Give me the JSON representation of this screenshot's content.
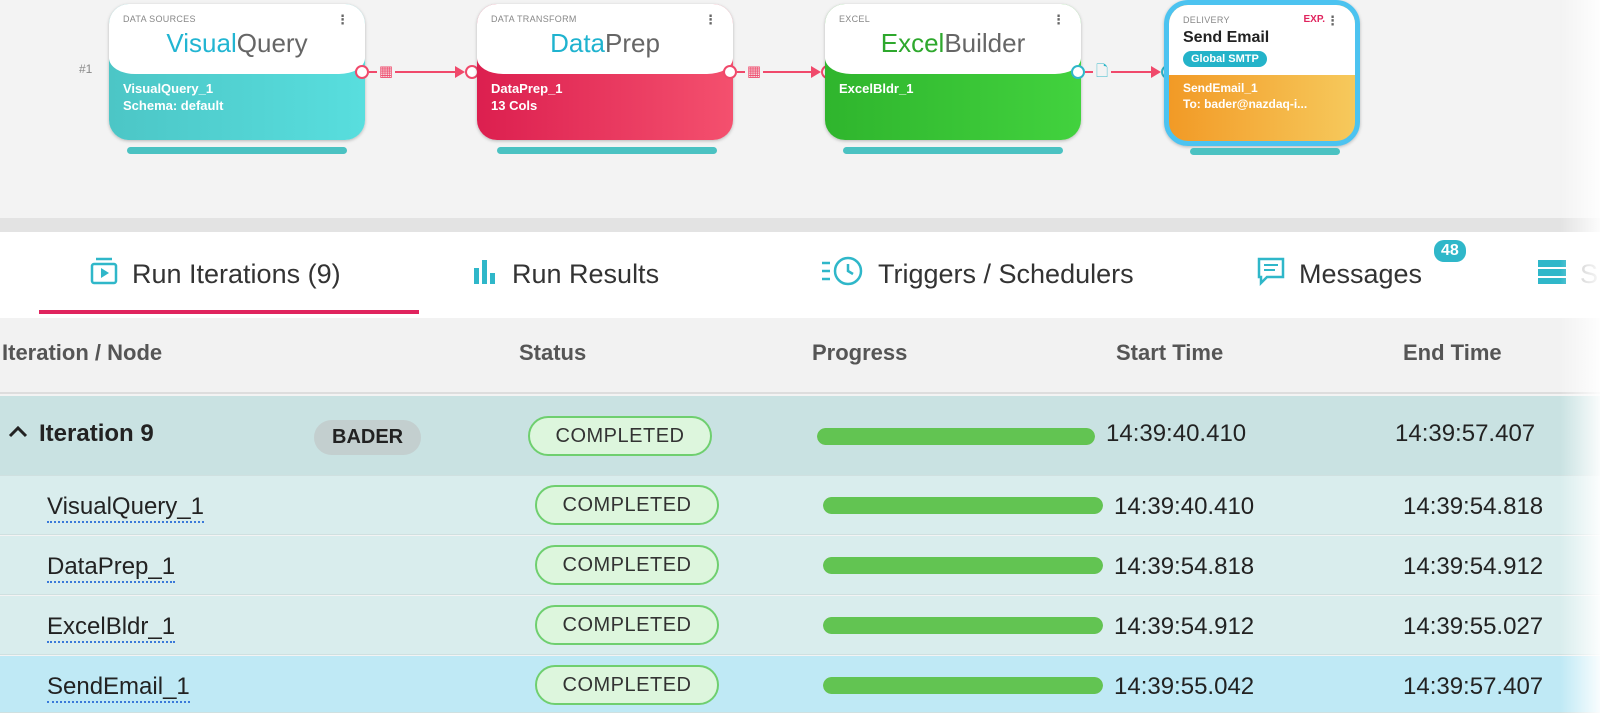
{
  "pipeline": {
    "row_label": "#1",
    "nodes": [
      {
        "category": "DATA SOURCES",
        "logo_a": "Visual",
        "logo_b": "Query",
        "line1": "VisualQuery_1",
        "line2": "Schema: default"
      },
      {
        "category": "DATA TRANSFORM",
        "logo_a": "Data",
        "logo_b": "Prep",
        "line1": "DataPrep_1",
        "line2": "13 Cols"
      },
      {
        "category": "EXCEL",
        "logo_a": "Excel",
        "logo_b": "Builder",
        "line1": "ExcelBldr_1",
        "line2": ""
      },
      {
        "category": "DELIVERY",
        "exp": "EXP.",
        "title": "Send Email",
        "badge": "Global SMTP",
        "line1": "SendEmail_1",
        "line2": "To: bader@nazdaq-i..."
      }
    ],
    "menu_glyph": "⋮"
  },
  "tabs": [
    {
      "label": "Run Iterations (9)",
      "icon": "play-list-icon"
    },
    {
      "label": "Run Results",
      "icon": "bar-chart-icon"
    },
    {
      "label": "Triggers / Schedulers",
      "icon": "clock-list-icon"
    },
    {
      "label": "Messages",
      "icon": "message-icon",
      "badge": "48"
    },
    {
      "label": "S",
      "icon": "server-icon"
    }
  ],
  "table": {
    "headers": [
      "Iteration / Node",
      "Status",
      "Progress",
      "Start Time",
      "End Time"
    ],
    "group": {
      "label": "Iteration 9",
      "user": "BADER",
      "status": "COMPLETED",
      "progress": 100,
      "start": "14:39:40.410",
      "end": "14:39:57.407"
    },
    "rows": [
      {
        "node": "VisualQuery_1",
        "status": "COMPLETED",
        "progress": 100,
        "start": "14:39:40.410",
        "end": "14:39:54.818"
      },
      {
        "node": "DataPrep_1",
        "status": "COMPLETED",
        "progress": 100,
        "start": "14:39:54.818",
        "end": "14:39:54.912"
      },
      {
        "node": "ExcelBldr_1",
        "status": "COMPLETED",
        "progress": 100,
        "start": "14:39:54.912",
        "end": "14:39:55.027"
      },
      {
        "node": "SendEmail_1",
        "status": "COMPLETED",
        "progress": 100,
        "start": "14:39:55.042",
        "end": "14:39:57.407"
      }
    ]
  },
  "colors": {
    "accent": "#e0245e",
    "teal": "#2fb7c9",
    "progress": "#62c452",
    "selected_row": "#bfe9f5",
    "row_bg": "#d9eded"
  }
}
